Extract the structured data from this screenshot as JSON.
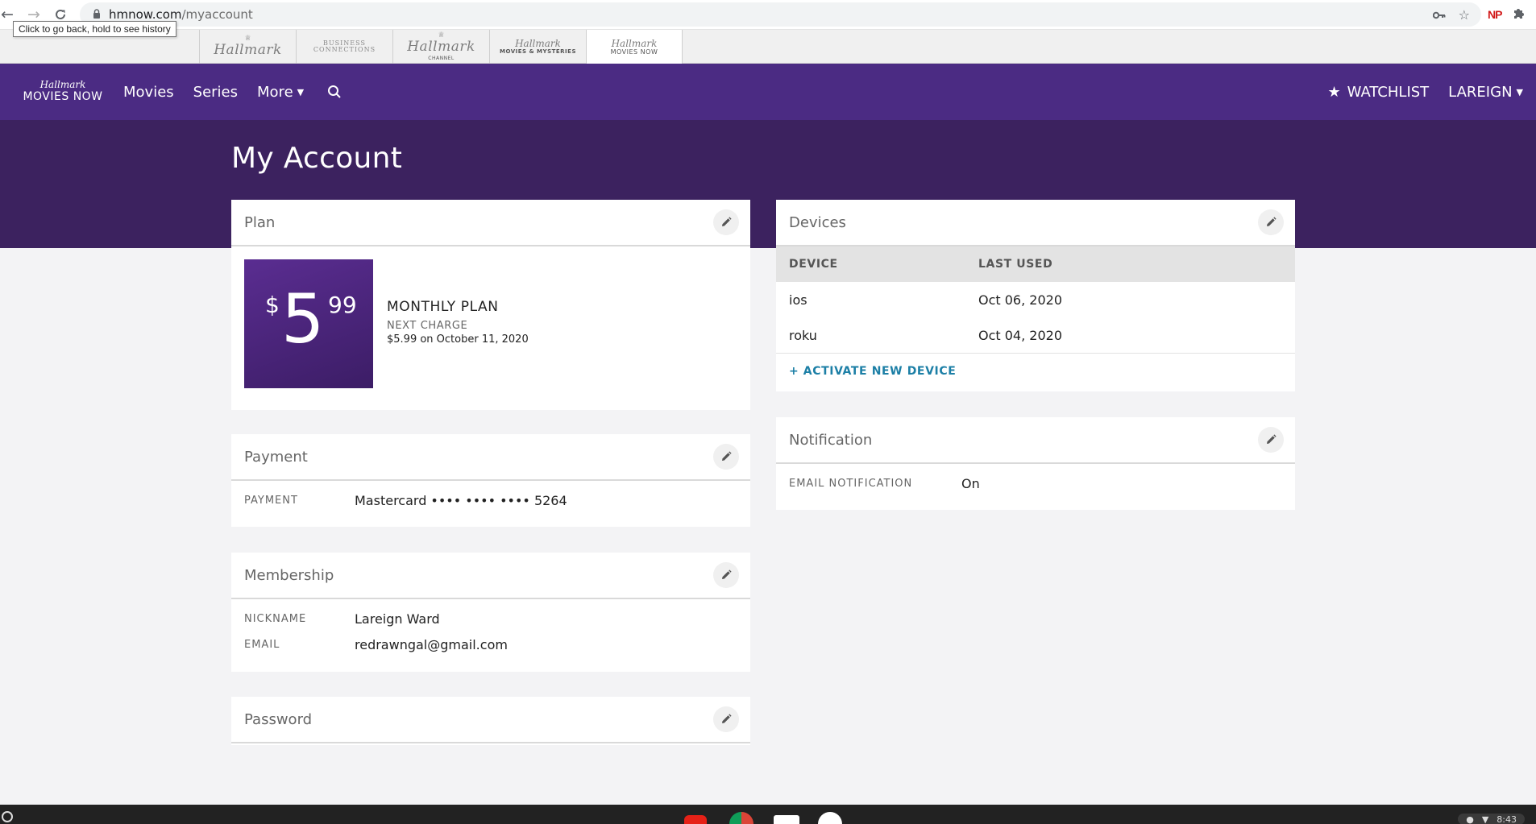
{
  "browser": {
    "url_host": "hmnow.com",
    "url_path": "/myaccount",
    "tooltip": "Click to go back, hold to see history",
    "extension_badge": "NP"
  },
  "brand_tabs": [
    {
      "script": "Hallmark",
      "sub": ""
    },
    {
      "script": "",
      "sub": "Business Connections"
    },
    {
      "script": "Hallmark",
      "sub": "Channel"
    },
    {
      "script": "Hallmark",
      "sub": "Movies & Mysteries"
    },
    {
      "script": "Hallmark",
      "sub": "Movies Now"
    }
  ],
  "header": {
    "logo_script": "Hallmark",
    "logo_text": "MOVIES NOW",
    "nav": [
      "Movies",
      "Series",
      "More"
    ],
    "watchlist": "WATCHLIST",
    "account": "LAREIGN"
  },
  "page": {
    "title": "My Account"
  },
  "plan": {
    "title": "Plan",
    "currency": "$",
    "price_main": "5",
    "price_cents": "99",
    "name": "MONTHLY PLAN",
    "next_label": "NEXT CHARGE",
    "next_value": "$5.99 on October 11, 2020"
  },
  "payment": {
    "title": "Payment",
    "label": "PAYMENT",
    "value": "Mastercard •••• •••• •••• 5264"
  },
  "membership": {
    "title": "Membership",
    "nickname_label": "NICKNAME",
    "nickname": "Lareign Ward",
    "email_label": "EMAIL",
    "email": "redrawngal@gmail.com"
  },
  "password": {
    "title": "Password"
  },
  "devices": {
    "title": "Devices",
    "col_device": "DEVICE",
    "col_last_used": "LAST USED",
    "rows": [
      {
        "device": "ios",
        "last_used": "Oct 06, 2020"
      },
      {
        "device": "roku",
        "last_used": "Oct 04, 2020"
      }
    ],
    "activate": "+ ACTIVATE NEW DEVICE"
  },
  "notification": {
    "title": "Notification",
    "label": "EMAIL NOTIFICATION",
    "value": "On"
  },
  "taskbar": {
    "time": "8:43"
  }
}
